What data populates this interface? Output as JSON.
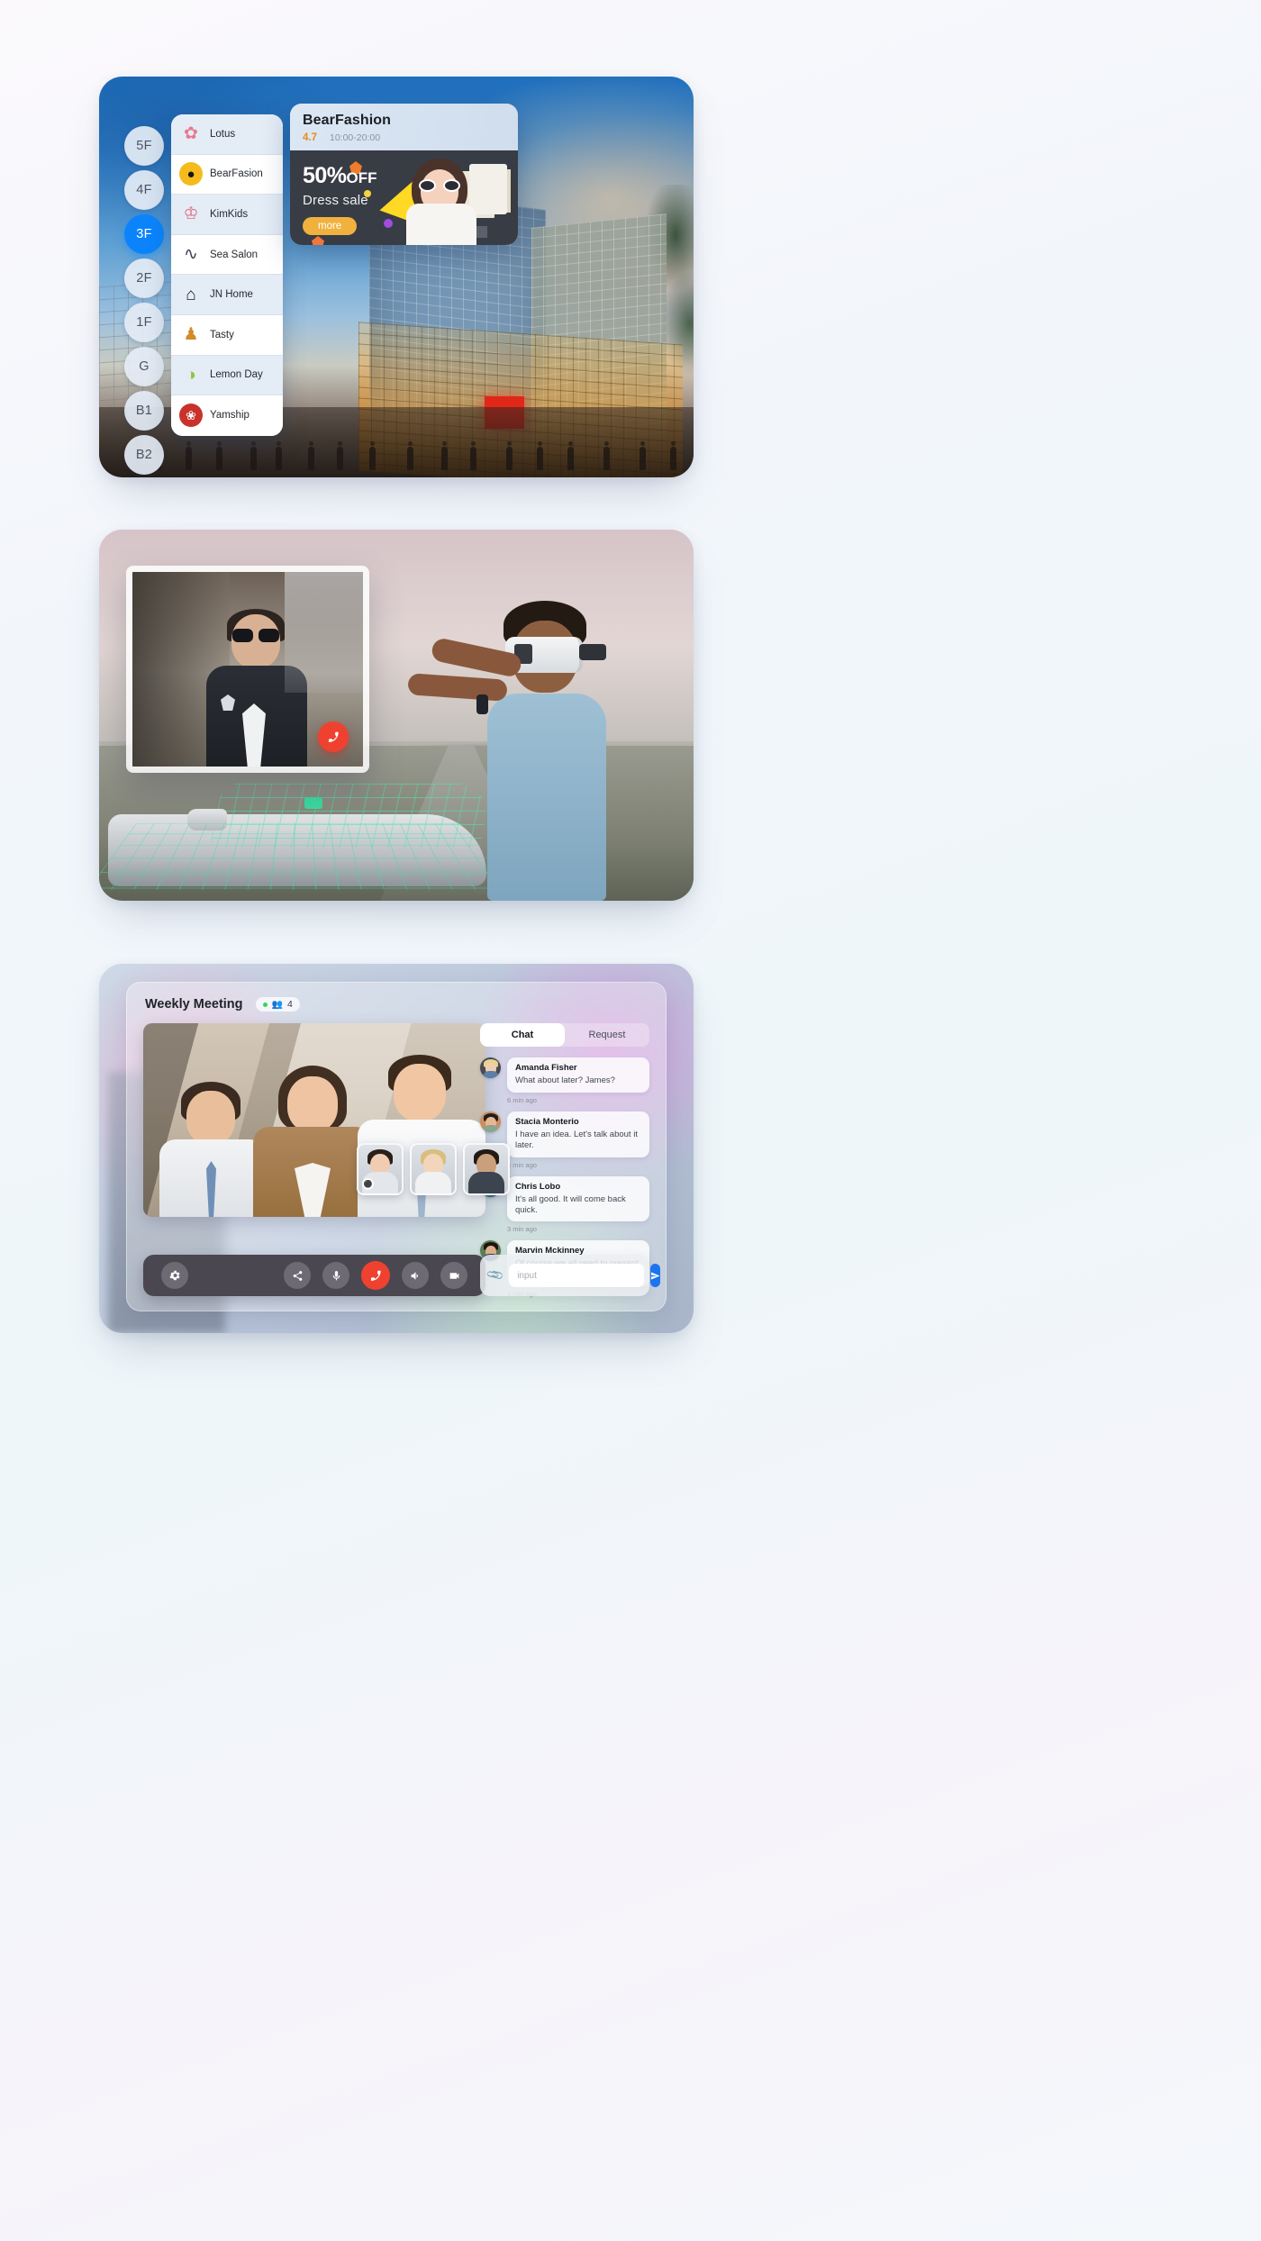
{
  "panel1": {
    "floors": [
      {
        "label": "5F",
        "active": false
      },
      {
        "label": "4F",
        "active": false
      },
      {
        "label": "3F",
        "active": true
      },
      {
        "label": "2F",
        "active": false
      },
      {
        "label": "1F",
        "active": false
      },
      {
        "label": "G",
        "active": false
      },
      {
        "label": "B1",
        "active": false
      },
      {
        "label": "B2",
        "active": false
      }
    ],
    "stores": [
      {
        "name": "Lotus",
        "icon": "lotus-flower-icon",
        "glyph": "✿",
        "selected": true
      },
      {
        "name": "BearFasion",
        "icon": "bear-sunrise-icon",
        "glyph": "◉",
        "selected": false
      },
      {
        "name": "KimKids",
        "icon": "kids-bear-icon",
        "glyph": "ὃB",
        "selected": true
      },
      {
        "name": "Sea Salon",
        "icon": "sea-wave-icon",
        "glyph": "∿",
        "selected": false
      },
      {
        "name": "JN Home",
        "icon": "jn-home-icon",
        "glyph": "⌂",
        "selected": true
      },
      {
        "name": "Tasty",
        "icon": "chef-icon",
        "glyph": "♟",
        "selected": false
      },
      {
        "name": "Lemon Day",
        "icon": "lemon-icon",
        "glyph": "◑",
        "selected": true
      },
      {
        "name": "Yamship",
        "icon": "yamship-icon",
        "glyph": "❀",
        "selected": false
      }
    ],
    "promo": {
      "title": "BearFashion",
      "rating": "4.7",
      "hours": "10:00-20:00",
      "discount_value": "50%",
      "discount_unit": "OFF",
      "subtitle": "Dress sale",
      "more_label": "more",
      "accent_color": "#f0b13f",
      "rating_color": "#eb8b18"
    }
  },
  "panel2": {
    "call": {
      "end_call_icon": "phone-hangup-icon"
    }
  },
  "panel3": {
    "header": {
      "title": "Weekly Meeting",
      "participants_icon": "people-icon",
      "participants_count": "4"
    },
    "tabs": [
      {
        "label": "Chat",
        "active": true
      },
      {
        "label": "Request",
        "active": false
      }
    ],
    "messages": [
      {
        "name": "Amanda Fisher",
        "text": "What about later?   James?",
        "time": "6 min ago",
        "avatar": {
          "skin": "#f0cdb2",
          "hair": "#e6d48c",
          "body": "#5b7fa8",
          "ring": "#4a4a52"
        }
      },
      {
        "name": "Stacia Monterio",
        "text": "I have an idea. Let's talk about it later.",
        "time": "4 min ago",
        "avatar": {
          "skin": "#e7b793",
          "hair": "#241c17",
          "body": "#8aa68e",
          "ring": "#c98f63"
        }
      },
      {
        "name": "Chris Lobo",
        "text": "It's all good. It will come back quick.",
        "time": "3 min ago",
        "avatar": {
          "skin": "#d89c6e",
          "hair": "#1d1712",
          "body": "#2f6b6b",
          "ring": "#b2603a"
        }
      },
      {
        "name": "Marvin Mckinney",
        "text": "Of course we all need to present it.",
        "time": "1 min ago",
        "avatar": {
          "skin": "#ddb08a",
          "hair": "#1b1510",
          "body": "#28425e",
          "ring": "#5d7c5a"
        }
      }
    ],
    "composer": {
      "attach_icon": "paperclip-icon",
      "input_placeholder": "input",
      "input_value": "",
      "send_icon": "send-icon",
      "send_color": "#1b74f0"
    },
    "controls": [
      {
        "name": "settings",
        "icon": "gear-icon",
        "glyph": "⚙",
        "variant": "default"
      },
      {
        "name": "share",
        "icon": "share-icon",
        "glyph": "∴",
        "variant": "default"
      },
      {
        "name": "mic",
        "icon": "microphone-icon",
        "glyph": "Ἲ4",
        "variant": "default"
      },
      {
        "name": "hangup",
        "icon": "phone-hangup-icon",
        "glyph": "☎",
        "variant": "hangup"
      },
      {
        "name": "speaker",
        "icon": "speaker-icon",
        "glyph": "ὐ9",
        "variant": "default"
      },
      {
        "name": "camera",
        "icon": "video-camera-icon",
        "glyph": "▶",
        "variant": "default"
      }
    ],
    "thumbnails": [
      {
        "skin": "#f0cdb2",
        "hair": "#2b2018",
        "body": "#e3e6ea",
        "muted": true
      },
      {
        "skin": "#f3d5bb",
        "hair": "#d8bf7e",
        "body": "#f0f1f3",
        "muted": false
      },
      {
        "skin": "#caa07c",
        "hair": "#231a14",
        "body": "#3c4450",
        "muted": false
      }
    ]
  }
}
